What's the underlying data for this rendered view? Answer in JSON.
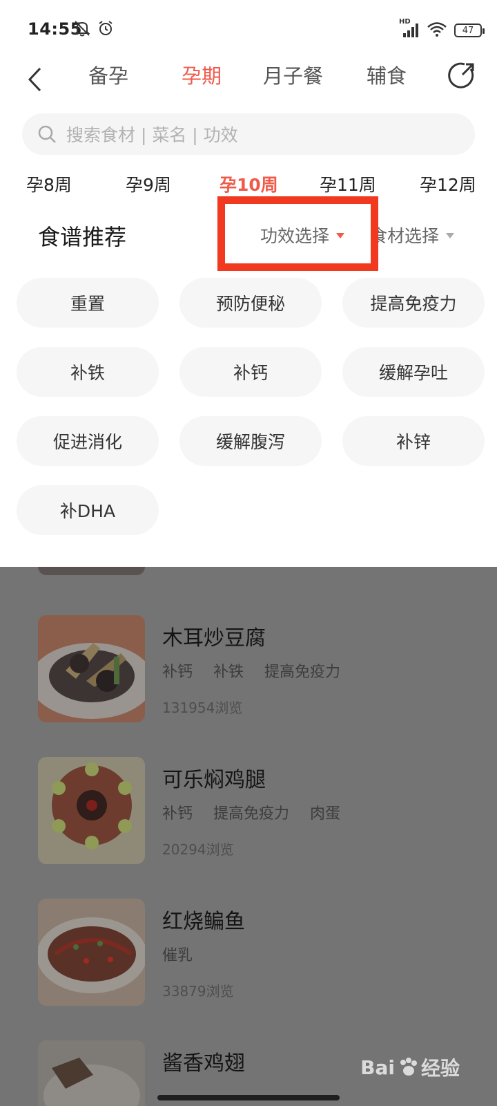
{
  "status_bar": {
    "time": "14:55",
    "battery": "47",
    "network_label": "HD"
  },
  "nav": {
    "tabs": [
      {
        "label": "备孕"
      },
      {
        "label": "孕期"
      },
      {
        "label": "月子餐"
      },
      {
        "label": "辅食"
      }
    ],
    "active_tab": "孕期",
    "accent_color": "#f05a4a"
  },
  "search": {
    "placeholder": "搜索食材 | 菜名 | 功效"
  },
  "weeks": {
    "items": [
      {
        "label": "孕8周"
      },
      {
        "label": "孕9周"
      },
      {
        "label": "孕10周"
      },
      {
        "label": "孕11周"
      },
      {
        "label": "孕12周"
      }
    ],
    "active": "孕10周"
  },
  "section": {
    "title": "食谱推荐",
    "filter_effect": "功效选择",
    "filter_ingredient": "食材选择"
  },
  "chips": [
    {
      "label": "重置"
    },
    {
      "label": "预防便秘"
    },
    {
      "label": "提高免疫力"
    },
    {
      "label": "补铁"
    },
    {
      "label": "补钙"
    },
    {
      "label": "缓解孕吐"
    },
    {
      "label": "促进消化"
    },
    {
      "label": "缓解腹泻"
    },
    {
      "label": "补锌"
    },
    {
      "label": "补DHA"
    }
  ],
  "recipes": [
    {
      "name": "木耳炒豆腐",
      "tags": [
        "补钙",
        "补铁",
        "提高免疫力"
      ],
      "views": "131954浏览"
    },
    {
      "name": "可乐焖鸡腿",
      "tags": [
        "补钙",
        "提高免疫力",
        "肉蛋"
      ],
      "views": "20294浏览"
    },
    {
      "name": "红烧鳊鱼",
      "tags": [
        "催乳"
      ],
      "views": "33879浏览"
    },
    {
      "name": "酱香鸡翅",
      "tags": [],
      "views": ""
    }
  ],
  "watermark": {
    "brand": "Bai",
    "suffix": "经验"
  }
}
